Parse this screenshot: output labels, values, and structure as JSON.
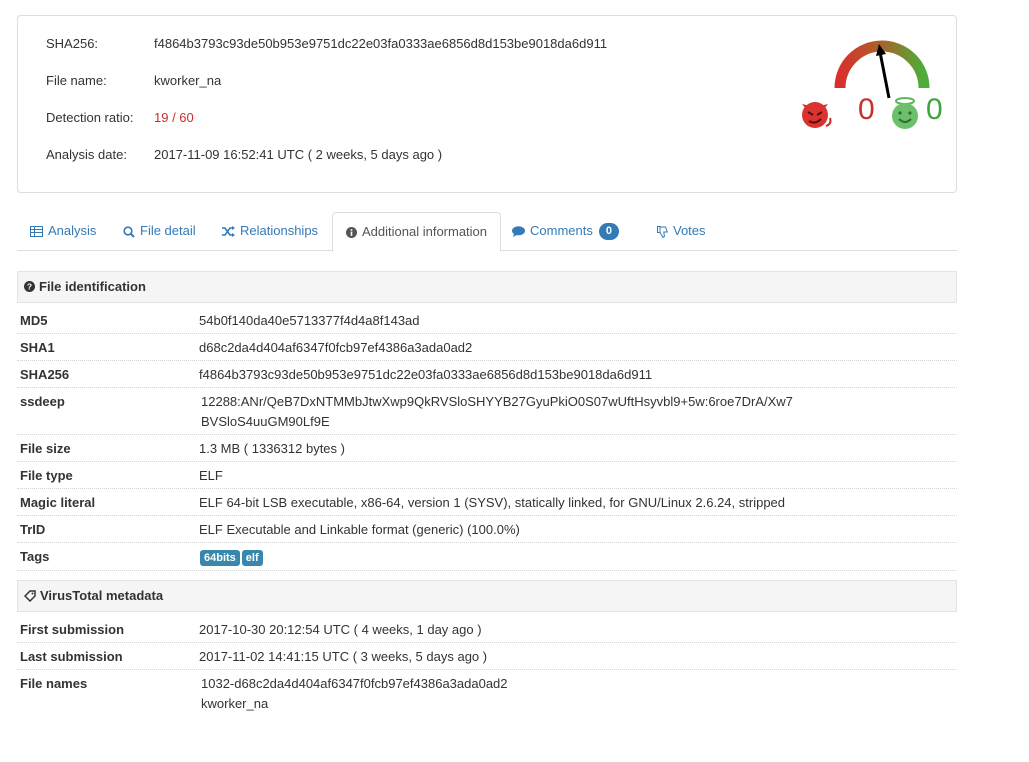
{
  "summary": {
    "sha256_label": "SHA256:",
    "sha256": "f4864b3793c93de50b953e9751dc22e03fa0333ae6856d8d153be9018da6d911",
    "filename_label": "File name:",
    "filename": "kworker_na",
    "detection_label": "Detection ratio:",
    "detection": "19 / 60",
    "date_label": "Analysis date:",
    "date": "2017-11-09 16:52:41 UTC ( 2 weeks, 5 days ago )"
  },
  "votes": {
    "malicious": "0",
    "harmless": "0"
  },
  "colors": {
    "link": "#337ab7",
    "danger": "#c9302c",
    "good": "#3fa63f",
    "tag": "#3a87ad"
  },
  "tabs": [
    {
      "label": "Analysis",
      "icon": "table-icon"
    },
    {
      "label": "File detail",
      "icon": "search-icon"
    },
    {
      "label": "Relationships",
      "icon": "shuffle-icon"
    },
    {
      "label": "Additional information",
      "icon": "info-icon",
      "active": true
    },
    {
      "label": "Comments",
      "icon": "comment-icon",
      "badge": "0"
    },
    {
      "label": "Votes",
      "icon": "thumbs-down-icon"
    }
  ],
  "file_identification": {
    "title": "File identification",
    "rows": [
      {
        "key": "MD5",
        "value": "54b0f140da40e5713377f4d4a8f143ad"
      },
      {
        "key": "SHA1",
        "value": "d68c2da4d404af6347f0fcb97ef4386a3ada0ad2"
      },
      {
        "key": "SHA256",
        "value": "f4864b3793c93de50b953e9751dc22e03fa0333ae6856d8d153be9018da6d911"
      },
      {
        "key": "ssdeep",
        "value": "12288:ANr/QeB7DxNTMMbJtwXwp9QkRVSloSHYYB27GyuPkiO0S07wUftHsyvbl9+5w:6roe7DrA/Xw7",
        "value2": "BVSloS4uuGM90Lf9E"
      },
      {
        "key": "File size",
        "value": "1.3 MB ( 1336312 bytes )"
      },
      {
        "key": "File type",
        "value": "ELF"
      },
      {
        "key": "Magic literal",
        "value": "ELF 64-bit LSB executable, x86-64, version 1 (SYSV), statically linked, for GNU/Linux 2.6.24, stripped"
      },
      {
        "key": "TrID",
        "value": "ELF Executable and Linkable format (generic) (100.0%)"
      },
      {
        "key": "Tags",
        "tags": [
          "64bits",
          "elf"
        ]
      }
    ]
  },
  "virustotal_metadata": {
    "title": "VirusTotal metadata",
    "rows": [
      {
        "key": "First submission",
        "value": "2017-10-30 20:12:54 UTC ( 4 weeks, 1 day ago )"
      },
      {
        "key": "Last submission",
        "value": "2017-11-02 14:41:15 UTC ( 3 weeks, 5 days ago )"
      },
      {
        "key": "File names",
        "value": "1032-d68c2da4d404af6347f0fcb97ef4386a3ada0ad2",
        "value2": "kworker_na"
      }
    ]
  }
}
